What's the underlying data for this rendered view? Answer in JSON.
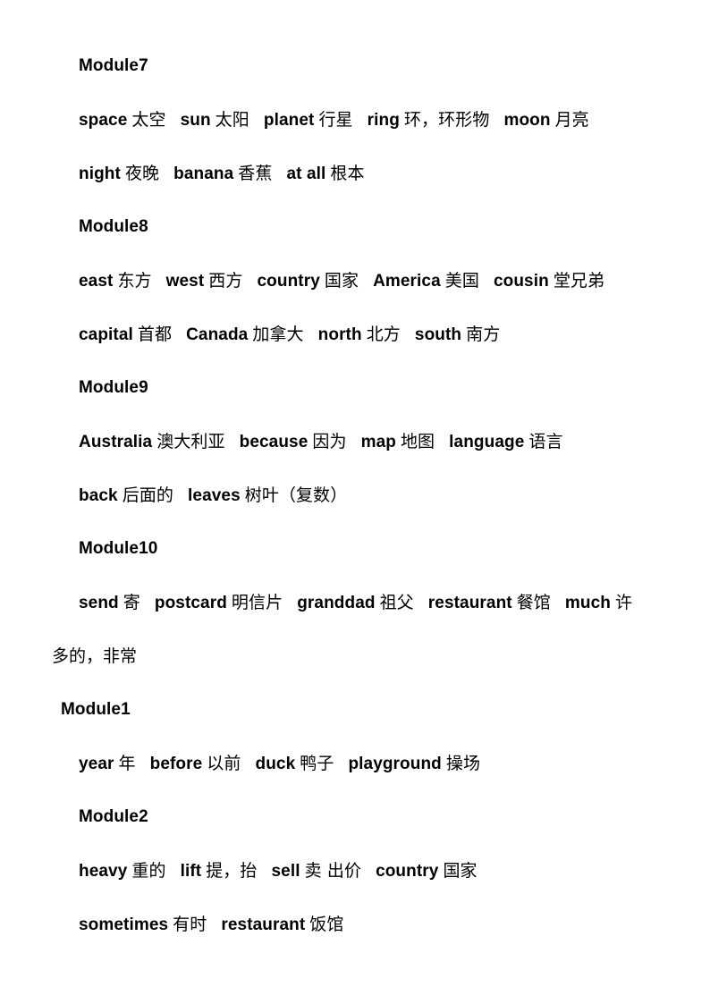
{
  "document": {
    "background_color": "#ffffff",
    "text_color": "#000000"
  },
  "blocks": [
    {
      "heading": "Module7",
      "lines": [
        {
          "entries": [
            {
              "en": "space",
              "zh": "太空"
            },
            {
              "en": "sun",
              "zh": "太阳"
            },
            {
              "en": "planet",
              "zh": "行星"
            },
            {
              "en": "ring",
              "zh": "环，环形物"
            },
            {
              "en": "moon",
              "zh": "月亮"
            }
          ]
        },
        {
          "entries": [
            {
              "en": "night",
              "zh": "夜晚"
            },
            {
              "en": "banana",
              "zh": "香蕉"
            },
            {
              "en": "at all",
              "zh": "根本"
            }
          ]
        }
      ]
    },
    {
      "heading": "Module8",
      "lines": [
        {
          "entries": [
            {
              "en": "east",
              "zh": "东方"
            },
            {
              "en": "west",
              "zh": "西方"
            },
            {
              "en": "country",
              "zh": "国家"
            },
            {
              "en": "America",
              "zh": "美国"
            },
            {
              "en": "cousin",
              "zh": "堂兄弟"
            }
          ]
        },
        {
          "entries": [
            {
              "en": "capital",
              "zh": "首都"
            },
            {
              "en": "Canada",
              "zh": "加拿大"
            },
            {
              "en": "north",
              "zh": "北方"
            },
            {
              "en": "south",
              "zh": "南方"
            }
          ]
        }
      ]
    },
    {
      "heading": "Module9",
      "lines": [
        {
          "entries": [
            {
              "en": "Australia",
              "zh": "澳大利亚"
            },
            {
              "en": "because",
              "zh": "因为"
            },
            {
              "en": "map",
              "zh": "地图"
            },
            {
              "en": "language",
              "zh": "语言"
            }
          ]
        },
        {
          "entries": [
            {
              "en": "back",
              "zh": "后面的"
            },
            {
              "en": "leaves",
              "zh": "树叶（复数）"
            }
          ]
        }
      ]
    },
    {
      "heading": "Module10",
      "lines": [
        {
          "entries": [
            {
              "en": "send",
              "zh": "寄"
            },
            {
              "en": "postcard",
              "zh": "明信片"
            },
            {
              "en": "granddad",
              "zh": "祖父"
            },
            {
              "en": "restaurant",
              "zh": "餐馆"
            },
            {
              "en": "much",
              "zh": "许"
            }
          ],
          "wrap_tail": "多的，非常"
        }
      ]
    },
    {
      "heading": "Module1",
      "heading_indent": "small",
      "lines": [
        {
          "entries": [
            {
              "en": "year",
              "zh": "年"
            },
            {
              "en": "before",
              "zh": "以前"
            },
            {
              "en": "duck",
              "zh": "鸭子"
            },
            {
              "en": "playground",
              "zh": "操场"
            }
          ]
        }
      ]
    },
    {
      "heading": "Module2",
      "lines": [
        {
          "entries": [
            {
              "en": "heavy",
              "zh": "重的"
            },
            {
              "en": "lift",
              "zh": "提，抬"
            },
            {
              "en": "sell",
              "zh": "卖 出价"
            },
            {
              "en": "country",
              "zh": "国家"
            }
          ]
        },
        {
          "entries": [
            {
              "en": "sometimes",
              "zh": "有时"
            },
            {
              "en": "restaurant",
              "zh": "饭馆"
            }
          ]
        }
      ]
    }
  ]
}
